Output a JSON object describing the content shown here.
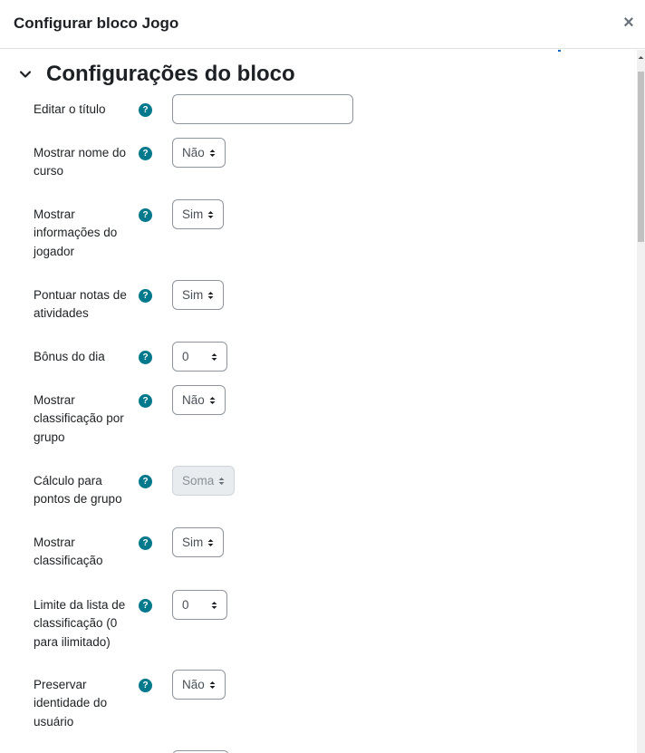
{
  "dialog": {
    "title": "Configurar bloco Jogo",
    "close_symbol": "×",
    "close_icon": "close-icon"
  },
  "section": {
    "title": "Configurações do bloco",
    "chevron_icon": "chevron-down-icon"
  },
  "help_icon": {
    "symbol": "?",
    "name": "help-icon",
    "color": "#00798c"
  },
  "fields": {
    "edit_title": {
      "label": "Editar o título",
      "value": "",
      "placeholder": ""
    },
    "show_course_name": {
      "label": "Mostrar nome do curso",
      "value": "Não"
    },
    "show_player_info": {
      "label": "Mostrar informações do jogador",
      "value": "Sim"
    },
    "score_activities": {
      "label": "Pontuar notas de atividades",
      "value": "Sim"
    },
    "daily_bonus": {
      "label": "Bônus do dia",
      "value": "0"
    },
    "group_ranking": {
      "label": "Mostrar classificação por grupo",
      "value": "Não"
    },
    "group_points_calc": {
      "label": "Cálculo para pontos de grupo",
      "value": "Soma",
      "disabled": true
    },
    "show_ranking": {
      "label": "Mostrar classificação",
      "value": "Sim"
    },
    "ranking_limit": {
      "label": "Limite da lista de classificação (0 para ilimitado)",
      "value": "0"
    },
    "preserve_identity": {
      "label": "Preservar identidade do usuário",
      "value": "Não"
    }
  }
}
